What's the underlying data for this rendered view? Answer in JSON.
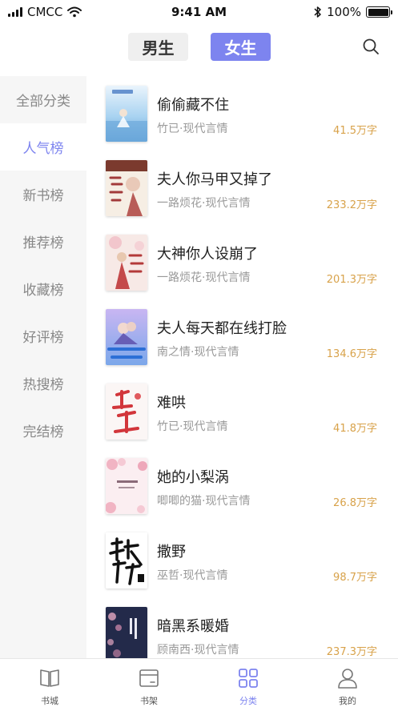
{
  "status_bar": {
    "carrier": "CMCC",
    "time": "9:41 AM",
    "battery": "100%"
  },
  "gender_tabs": {
    "male": "男生",
    "female": "女生",
    "active": "female"
  },
  "sidebar": {
    "items": [
      {
        "label": "全部分类"
      },
      {
        "label": "人气榜",
        "active": true
      },
      {
        "label": "新书榜"
      },
      {
        "label": "推荐榜"
      },
      {
        "label": "收藏榜"
      },
      {
        "label": "好评榜"
      },
      {
        "label": "热搜榜"
      },
      {
        "label": "完结榜"
      }
    ]
  },
  "books": [
    {
      "title": "偷偷藏不住",
      "meta": "竹已·现代言情",
      "words": "41.5万字"
    },
    {
      "title": "夫人你马甲又掉了",
      "meta": "一路烦花·现代言情",
      "words": "233.2万字"
    },
    {
      "title": "大神你人设崩了",
      "meta": "一路烦花·现代言情",
      "words": "201.3万字"
    },
    {
      "title": "夫人每天都在线打脸",
      "meta": "南之情·现代言情",
      "words": "134.6万字"
    },
    {
      "title": "难哄",
      "meta": "竹已·现代言情",
      "words": "41.8万字"
    },
    {
      "title": "她的小梨涡",
      "meta": "唧唧的猫·现代言情",
      "words": "26.8万字"
    },
    {
      "title": "撒野",
      "meta": "巫哲·现代言情",
      "words": "98.7万字"
    },
    {
      "title": "暗黑系暖婚",
      "meta": "顾南西·现代言情",
      "words": "237.3万字"
    }
  ],
  "bottom_nav": {
    "items": [
      {
        "label": "书城",
        "icon": "book-open-icon"
      },
      {
        "label": "书架",
        "icon": "bookshelf-icon"
      },
      {
        "label": "分类",
        "icon": "category-grid-icon",
        "active": true
      },
      {
        "label": "我的",
        "icon": "profile-icon"
      }
    ]
  },
  "colors": {
    "accent": "#7d84ef",
    "word_count": "#d8a24a",
    "sidebar_bg": "#f6f6f6",
    "meta_text": "#999999"
  }
}
